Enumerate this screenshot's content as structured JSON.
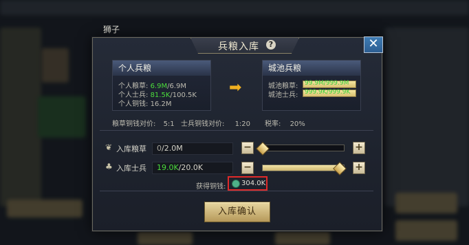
{
  "background": {
    "name_label": "狮子"
  },
  "dialog": {
    "title": "兵粮入库",
    "help": "?",
    "close": "✕",
    "personal": {
      "header": "个人兵粮",
      "grain_label": "个人粮草:",
      "grain_current": "6.9M",
      "grain_max": "/6.9M",
      "soldiers_label": "个人士兵:",
      "soldiers_current": "81.5K",
      "soldiers_max": "/100.5K",
      "copper_label": "个人铜钱:",
      "copper_value": "16.2M"
    },
    "city": {
      "header": "城池兵粮",
      "grain_label": "城池粮草:",
      "grain_value": "99.9M/999.9M",
      "soldiers_label": "城池士兵:",
      "soldiers_value": "999.9K/999.9K"
    },
    "rates": {
      "grain_copper_label": "粮草铜钱对价:",
      "grain_copper_value": "5:1",
      "soldier_copper_label": "士兵铜钱对价:",
      "soldier_copper_value": "1:20",
      "tax_label": "税率:",
      "tax_value": "20%"
    },
    "deposit_grain": {
      "label": "入库粮草",
      "current": "0",
      "max": "/2.0M",
      "level": 0.0
    },
    "deposit_soldiers": {
      "label": "入库士兵",
      "current": "19.0K",
      "max": "/20.0K",
      "level": 0.95
    },
    "copper_gain": {
      "label": "获得铜钱:",
      "value": "304.0K"
    },
    "confirm_label": "入库确认"
  },
  "colors": {
    "accent_green": "#4cdc3c",
    "highlight_red": "#e02a2a",
    "gold": "#c9a04a"
  }
}
